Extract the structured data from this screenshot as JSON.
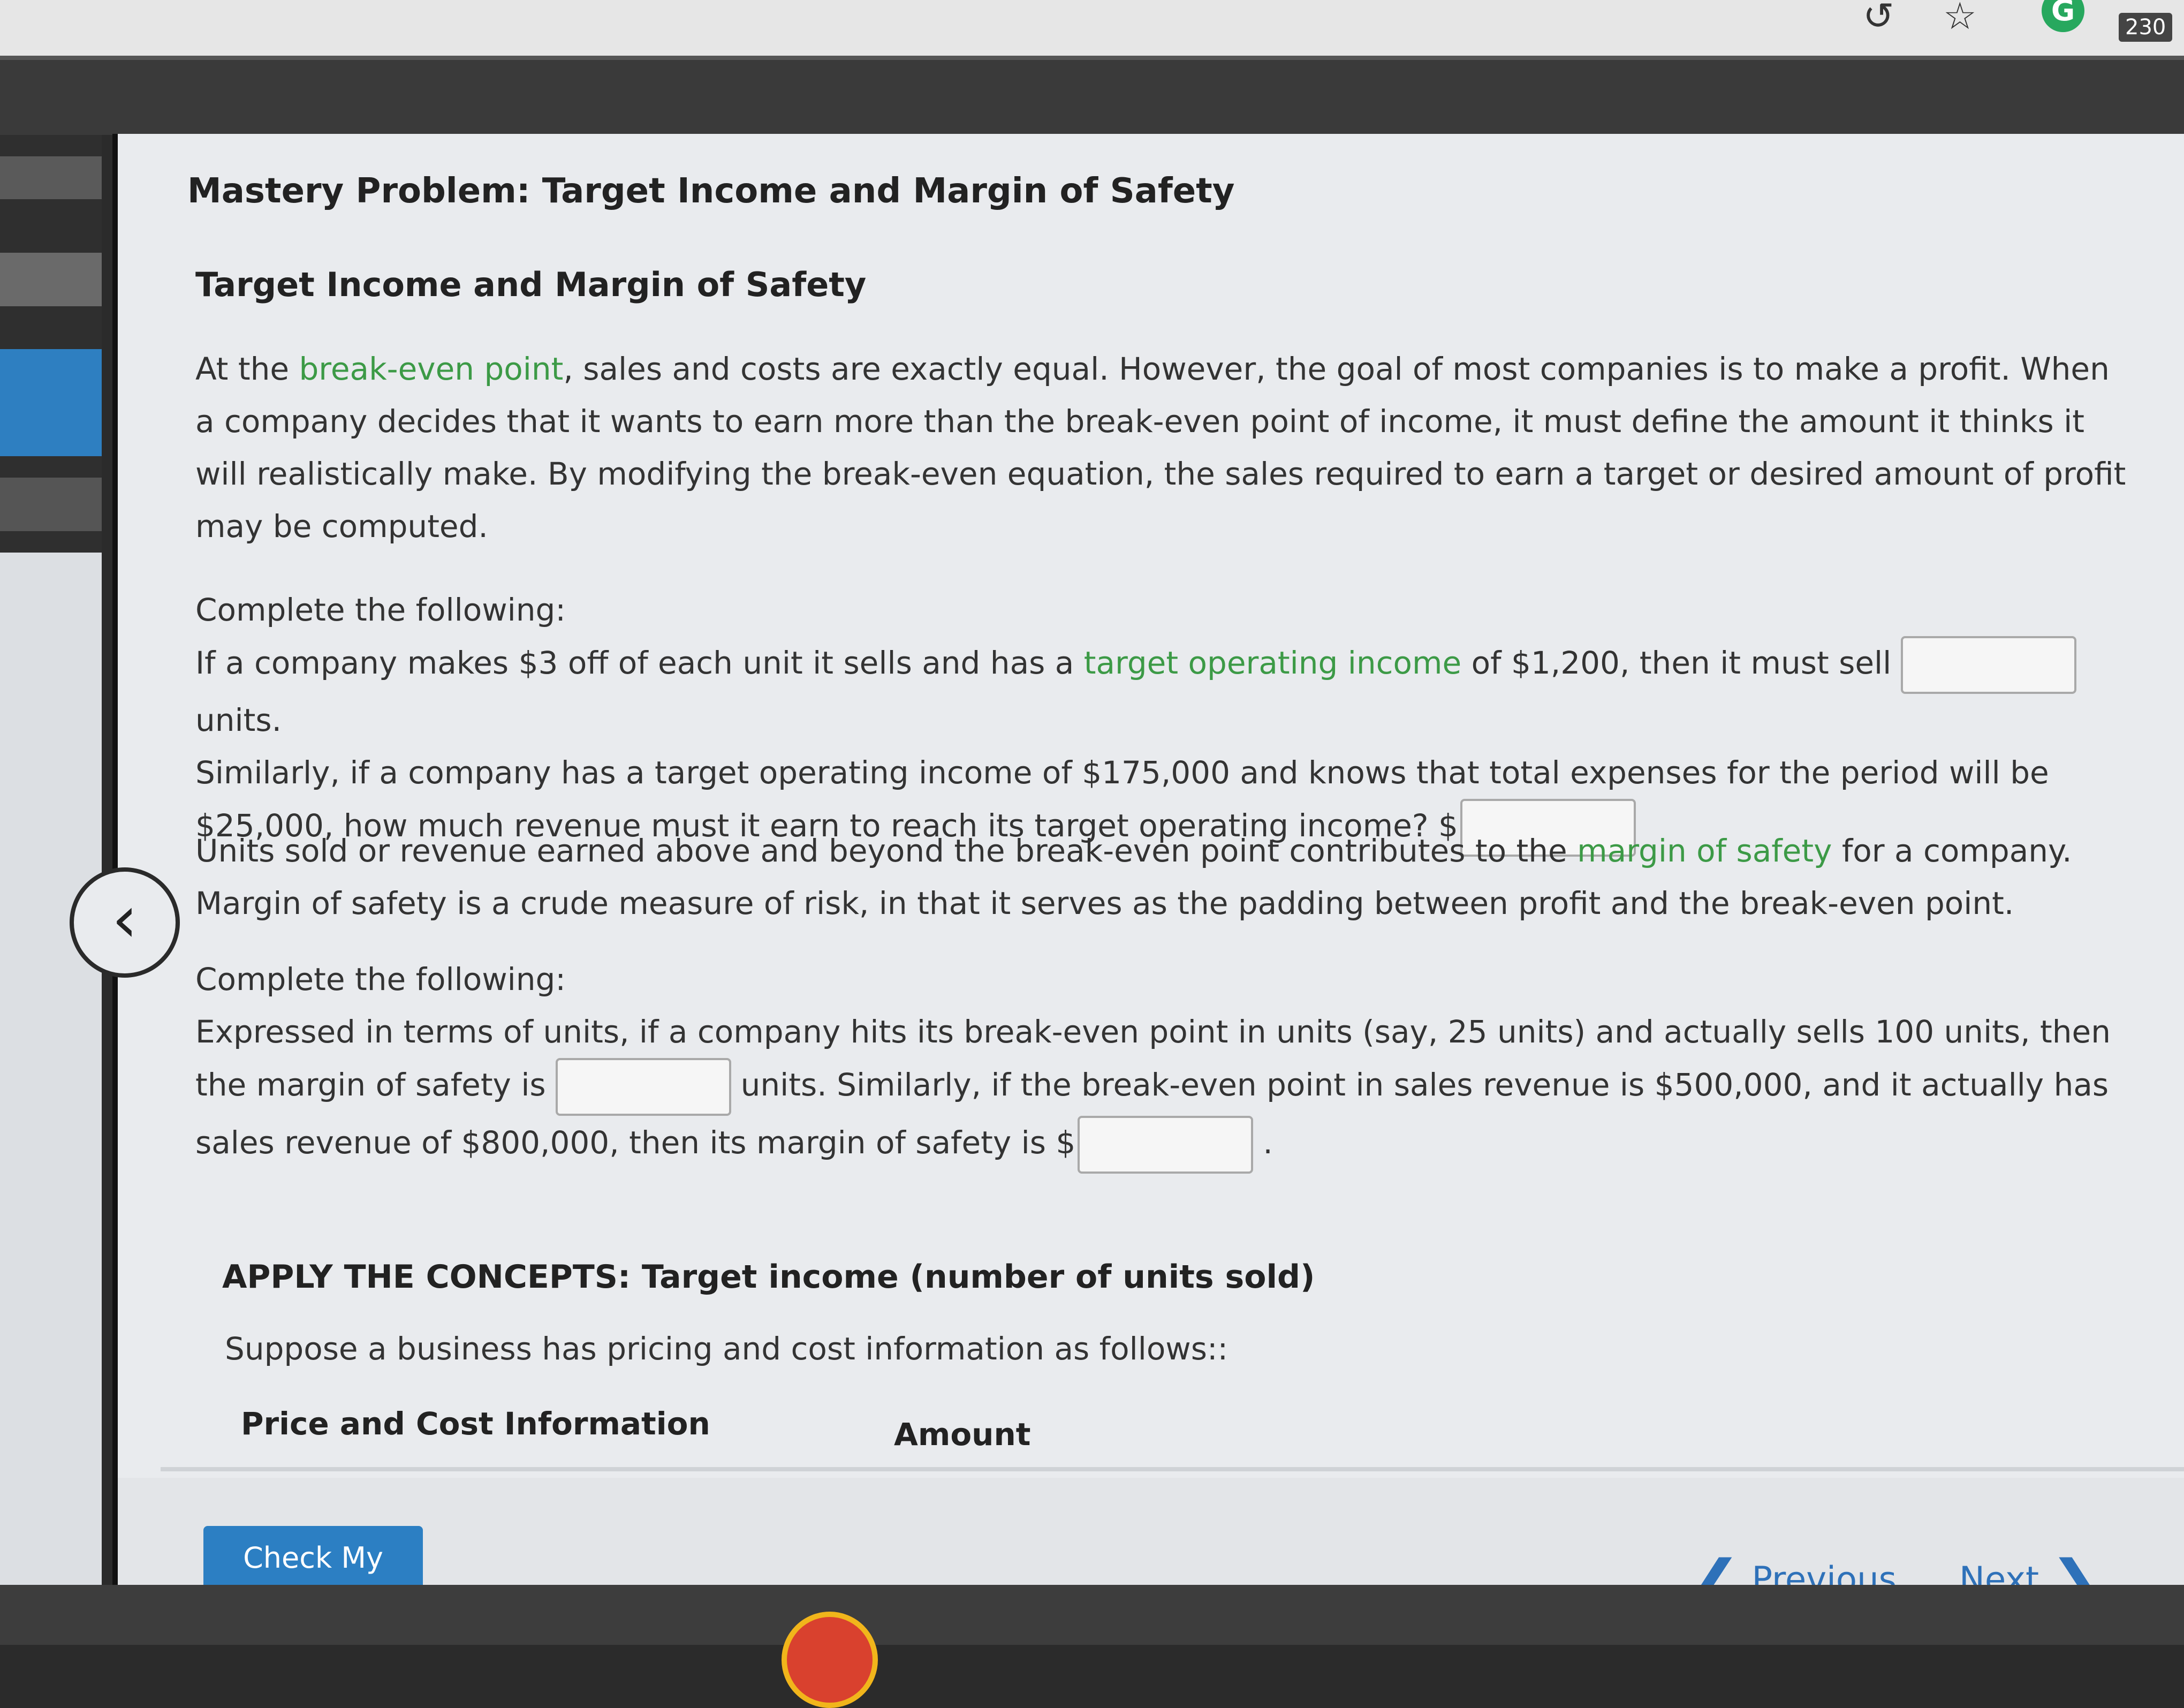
{
  "browser": {
    "star_icon": "star-icon",
    "share_icon": "share-icon",
    "extension_letter": "G",
    "extension_badge": "230"
  },
  "page_title": "Mastery Problem: Target Income and Margin of Safety",
  "section_title": "Target Income and Margin of Safety",
  "intro": {
    "before": "At the ",
    "link": "break-even point",
    "after": ", sales and costs are exactly equal. However, the goal of most companies is to make a profit. When a company decides that it wants to earn more than the break-even point of income, it must define the amount it thinks it will realistically make. By modifying the break-even equation, the sales required to earn a target or desired amount of profit may be computed."
  },
  "q1": {
    "lead": "Complete the following:",
    "line1_before": "If a company makes $3 off of each unit it sells and has a ",
    "line1_link": "target operating income",
    "line1_after": " of $1,200, then it must sell",
    "line1_unit": "units.",
    "line2": "Similarly, if a company has a target operating income of $175,000 and knows that total expenses for the period will be $25,000, how much revenue must it earn to reach its target operating income? $"
  },
  "safety": {
    "before": "Units sold or revenue earned above and beyond the break-even point contributes to the ",
    "link": "margin of safety",
    "after": " for a company. Margin of safety is a crude measure of risk, in that it serves as the padding between profit and the break-even point."
  },
  "q2": {
    "lead": "Complete the following:",
    "text1": "Expressed in terms of units, if a company hits its break-even point in units (say, 25 units) and actually sells 100 units, then the margin of safety is",
    "text2": "units. Similarly, if the break-even point in sales revenue is $500,000, and it actually has sales revenue of $800,000, then its margin of safety is $",
    "text3": "."
  },
  "apply": {
    "title": "APPLY THE CONCEPTS: Target income (number of units sold)",
    "intro": "Suppose a business has pricing and cost information as follows::",
    "col1": "Price and Cost Information",
    "col2": "Amount"
  },
  "footer": {
    "check_label": "Check My Work",
    "previous_label": "Previous",
    "next_label": "Next"
  },
  "colors": {
    "link_green": "#3c9a46",
    "button_blue": "#2c7fc3",
    "nav_blue": "#2e71b9"
  }
}
